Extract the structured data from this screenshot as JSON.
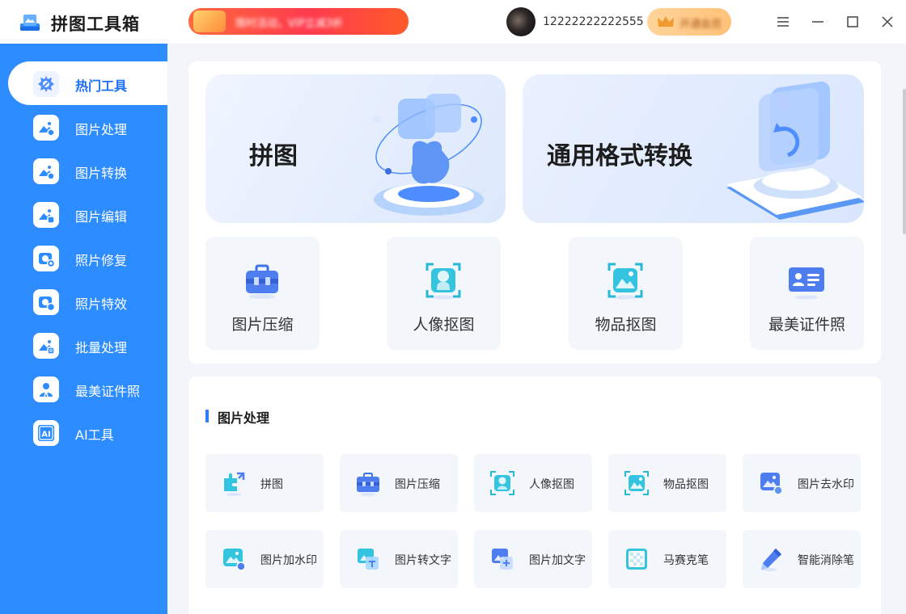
{
  "app": {
    "title": "拼图工具箱",
    "username": "12222222222555"
  },
  "banner": {
    "text": "限时活动，VIP立减3折"
  },
  "vip": {
    "label": "开通会员"
  },
  "sidebar": {
    "items": [
      {
        "label": "热门工具",
        "icon": "hot-tools-icon"
      },
      {
        "label": "图片处理",
        "icon": "image-process-icon"
      },
      {
        "label": "图片转换",
        "icon": "image-convert-icon"
      },
      {
        "label": "图片编辑",
        "icon": "image-edit-icon"
      },
      {
        "label": "照片修复",
        "icon": "photo-repair-icon"
      },
      {
        "label": "照片特效",
        "icon": "photo-effect-icon"
      },
      {
        "label": "批量处理",
        "icon": "batch-process-icon"
      },
      {
        "label": "最美证件照",
        "icon": "id-photo-icon"
      },
      {
        "label": "AI工具",
        "icon": "ai-icon"
      }
    ]
  },
  "hero": [
    {
      "title": "拼图",
      "icon": "puzzle-icon"
    },
    {
      "title": "通用格式转换",
      "icon": "format-convert-icon"
    }
  ],
  "tiles": [
    {
      "label": "图片压缩",
      "icon": "compress-icon"
    },
    {
      "label": "人像抠图",
      "icon": "portrait-cutout-icon"
    },
    {
      "label": "物品抠图",
      "icon": "object-cutout-icon"
    },
    {
      "label": "最美证件照",
      "icon": "id-card-icon"
    }
  ],
  "section": {
    "title": "图片处理"
  },
  "tools": [
    {
      "label": "拼图",
      "icon": "puzzle-icon"
    },
    {
      "label": "图片压缩",
      "icon": "compress-icon"
    },
    {
      "label": "人像抠图",
      "icon": "portrait-cutout-icon"
    },
    {
      "label": "物品抠图",
      "icon": "object-cutout-icon"
    },
    {
      "label": "图片去水印",
      "icon": "remove-watermark-icon"
    },
    {
      "label": "图片加水印",
      "icon": "add-watermark-icon"
    },
    {
      "label": "图片转文字",
      "icon": "image-to-text-icon"
    },
    {
      "label": "图片加文字",
      "icon": "add-text-icon"
    },
    {
      "label": "马赛克笔",
      "icon": "mosaic-icon"
    },
    {
      "label": "智能消除笔",
      "icon": "smart-eraser-icon"
    }
  ],
  "colors": {
    "accent": "#2d8cff",
    "sidebar": "#2d8cff",
    "vip": "#ffc27a",
    "banner": "#ff3b4e"
  }
}
